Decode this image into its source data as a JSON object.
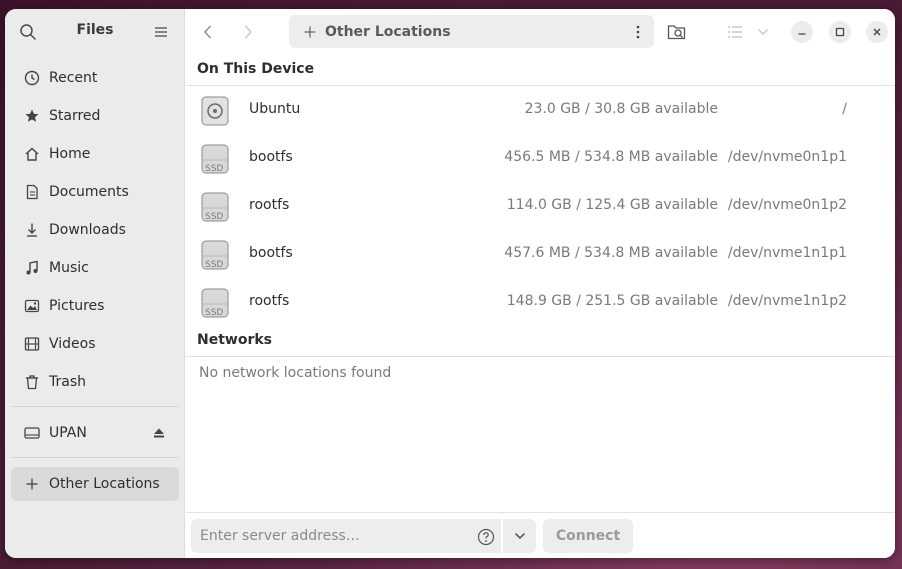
{
  "sidebar": {
    "title": "Files",
    "items": [
      {
        "label": "Recent",
        "icon": "clock-icon"
      },
      {
        "label": "Starred",
        "icon": "star-icon"
      },
      {
        "label": "Home",
        "icon": "home-icon"
      },
      {
        "label": "Documents",
        "icon": "document-icon"
      },
      {
        "label": "Downloads",
        "icon": "download-icon"
      },
      {
        "label": "Music",
        "icon": "music-icon"
      },
      {
        "label": "Pictures",
        "icon": "picture-icon"
      },
      {
        "label": "Videos",
        "icon": "video-icon"
      },
      {
        "label": "Trash",
        "icon": "trash-icon"
      }
    ],
    "devices": [
      {
        "label": "UPAN",
        "icon": "drive-icon"
      }
    ],
    "other_locations": "Other Locations"
  },
  "header": {
    "location": "Other Locations"
  },
  "on_this_device": {
    "title": "On This Device",
    "drives": [
      {
        "name": "Ubuntu",
        "space": "23.0 GB / 30.8 GB available",
        "device": "/",
        "icon": "disk-icon"
      },
      {
        "name": "bootfs",
        "space": "456.5 MB / 534.8 MB available",
        "device": "/dev/nvme0n1p1",
        "icon": "ssd-icon"
      },
      {
        "name": "rootfs",
        "space": "114.0 GB / 125.4 GB available",
        "device": "/dev/nvme0n1p2",
        "icon": "ssd-icon"
      },
      {
        "name": "bootfs",
        "space": "457.6 MB / 534.8 MB available",
        "device": "/dev/nvme1n1p1",
        "icon": "ssd-icon"
      },
      {
        "name": "rootfs",
        "space": "148.9 GB / 251.5 GB available",
        "device": "/dev/nvme1n1p2",
        "icon": "ssd-icon"
      }
    ],
    "ssd_label": "SSD"
  },
  "networks": {
    "title": "Networks",
    "empty": "No network locations found"
  },
  "footer": {
    "server_placeholder": "Enter server address…",
    "connect_label": "Connect"
  },
  "colors": {
    "sidebar_bg": "#ebebeb",
    "active_item_bg": "#d9d9d9",
    "window_bg": "#ffffff"
  }
}
